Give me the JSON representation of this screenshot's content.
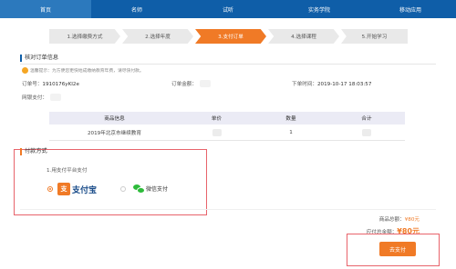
{
  "nav": {
    "items": [
      "首页",
      "名师",
      "试听",
      "实务学院",
      "移动应用"
    ]
  },
  "steps": [
    "1.选择缴费方式",
    "2.选择年度",
    "3.支付订单",
    "4.选择课程",
    "5.开始学习"
  ],
  "order_section": {
    "title": "核对订单信息",
    "tip": "温馨提示：为方便您更快地成缴纳教育年费，请尽快付款。",
    "order_no_label": "订单号：",
    "order_no_value": "1910176yKI2e",
    "amount_label": "订单金额：",
    "time_label": "下单时间：",
    "time_value": "2019-10-17 18:03:57",
    "online_pay_label": "网银支付："
  },
  "table": {
    "headers": [
      "商品信息",
      "单价",
      "数量",
      "合计"
    ],
    "rows": [
      {
        "product": "2019年北京市继续教育",
        "price": "",
        "quantity": "1",
        "total": ""
      }
    ]
  },
  "payment": {
    "section_title": "付款方式",
    "subtitle": "1.用支付平台支付",
    "alipay_label": "支付宝",
    "wechat_label": "微信支付"
  },
  "summary": {
    "goods_total_label": "商品总额：",
    "goods_total_value": "¥80元",
    "pay_total_label": "应付总金额：",
    "pay_total_value": "¥80元"
  },
  "actions": {
    "pay_button": "去支付"
  },
  "colors": {
    "nav_bg": "#0f5ea8",
    "accent": "#f07a26",
    "highlight_border": "#e8636b"
  }
}
